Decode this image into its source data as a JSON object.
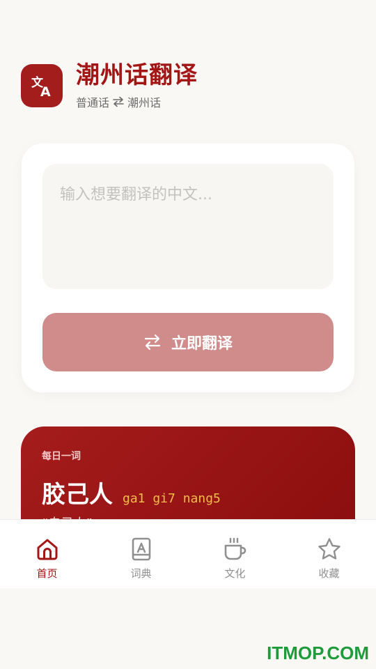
{
  "app": {
    "title": "潮州话翻译",
    "source_lang": "普通话",
    "target_lang": "潮州话",
    "accent_color": "#a31616"
  },
  "translator": {
    "input_value": "",
    "input_placeholder": "输入想要翻译的中文...",
    "button_label": "立即翻译"
  },
  "daily_word": {
    "label": "每日一词",
    "word": "胶己人",
    "pinyin": "ga1 gi7 nang5",
    "meaning": "“自己人”"
  },
  "nav": {
    "items": [
      {
        "label": "首页",
        "icon": "home-icon",
        "active": true
      },
      {
        "label": "词典",
        "icon": "dictionary-icon",
        "active": false
      },
      {
        "label": "文化",
        "icon": "cup-icon",
        "active": false
      },
      {
        "label": "收藏",
        "icon": "star-icon",
        "active": false
      }
    ]
  },
  "watermark": "ITMOP.COM"
}
